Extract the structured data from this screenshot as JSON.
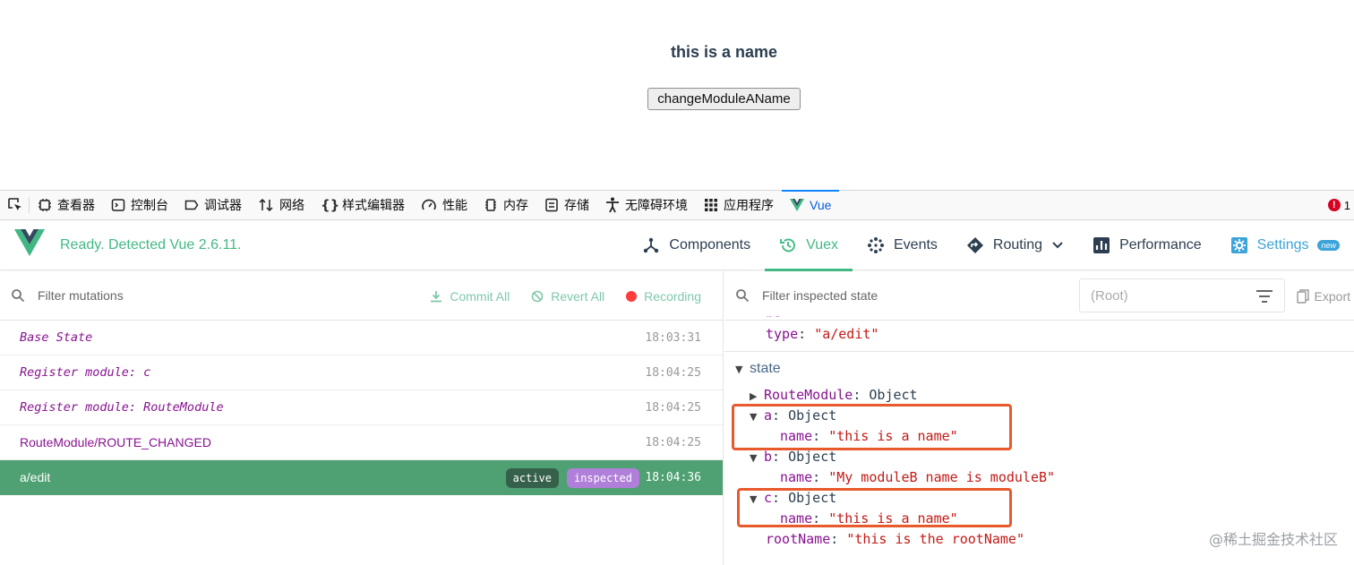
{
  "app": {
    "title": "this is a name",
    "button_label": "changeModuleAName"
  },
  "devtools": {
    "tabs": [
      {
        "label": "查看器",
        "icon": "inspector-icon"
      },
      {
        "label": "控制台",
        "icon": "console-icon"
      },
      {
        "label": "调试器",
        "icon": "debugger-icon"
      },
      {
        "label": "网络",
        "icon": "network-icon"
      },
      {
        "label": "样式编辑器",
        "icon": "style-editor-icon"
      },
      {
        "label": "性能",
        "icon": "performance-icon"
      },
      {
        "label": "内存",
        "icon": "memory-icon"
      },
      {
        "label": "存储",
        "icon": "storage-icon"
      },
      {
        "label": "无障碍环境",
        "icon": "accessibility-icon"
      },
      {
        "label": "应用程序",
        "icon": "application-icon"
      },
      {
        "label": "Vue",
        "icon": "vue-logo-icon"
      }
    ],
    "error_count": "1"
  },
  "vue_header": {
    "status": "Ready. Detected Vue 2.6.11.",
    "nav": {
      "components": "Components",
      "vuex": "Vuex",
      "events": "Events",
      "routing": "Routing",
      "performance": "Performance",
      "settings": "Settings",
      "new_badge": "new"
    },
    "accent_color": "#42b983"
  },
  "mutations": {
    "filter_placeholder": "Filter mutations",
    "commit_all": "Commit All",
    "revert_all": "Revert All",
    "recording": "Recording",
    "rows": [
      {
        "name": "Base State",
        "time": "18:03:31"
      },
      {
        "name": "Register module: c",
        "time": "18:04:25"
      },
      {
        "name": "Register module: RouteModule",
        "time": "18:04:25"
      },
      {
        "name": "RouteModule/ROUTE_CHANGED",
        "time": "18:04:25"
      },
      {
        "name": "a/edit",
        "time": "18:04:36",
        "tag_active": "active",
        "tag_inspected": "inspected"
      }
    ]
  },
  "inspector": {
    "filter_placeholder": "Filter inspected state",
    "root_select": "(Root)",
    "export": "Export",
    "mutation_type_key": "type",
    "mutation_type_value": "\"a/edit\"",
    "state_label": "state",
    "route_module_key": "RouteModule",
    "object_label": "Object",
    "a_key": "a",
    "a_name_key": "name",
    "a_name_value": "\"this is a name\"",
    "b_key": "b",
    "b_name_key": "name",
    "b_name_value": "\"My moduleB name is moduleB\"",
    "c_key": "c",
    "c_name_key": "name",
    "c_name_value": "\"this is a name\"",
    "root_name_key": "rootName",
    "root_name_value": "\"this is the rootName\"",
    "highlight_color": "#e8592c"
  },
  "watermark": "@稀土掘金技术社区"
}
